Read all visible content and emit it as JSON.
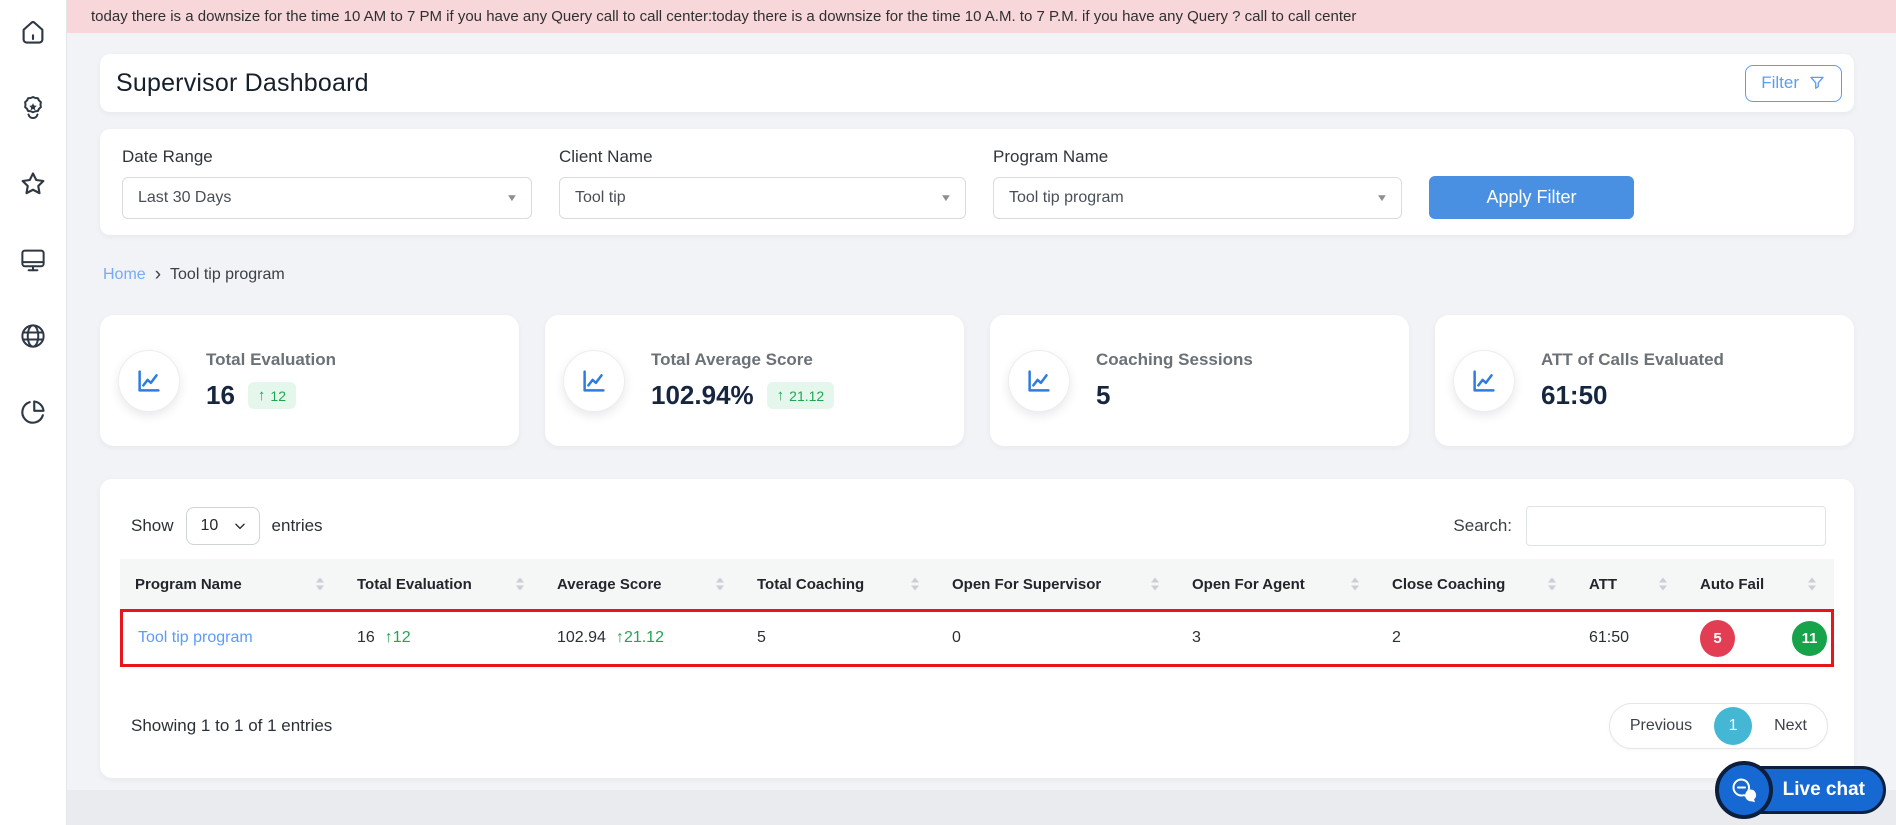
{
  "banner": {
    "text": "today there is a downsize for the time 10 AM to 7 PM if you have any Query call to call center:today there is a downsize for the time 10 A.M. to 7 P.M. if you have any Query ? call to call center"
  },
  "sidebar": {
    "items": [
      {
        "icon": "home-icon"
      },
      {
        "icon": "agent-badge-icon"
      },
      {
        "icon": "star-icon"
      },
      {
        "icon": "monitor-icon"
      },
      {
        "icon": "globe-icon"
      },
      {
        "icon": "pie-chart-icon"
      }
    ]
  },
  "header": {
    "title": "Supervisor Dashboard",
    "filter_button_label": "Filter"
  },
  "filters": {
    "date_range_label": "Date Range",
    "date_range_value": "Last 30 Days",
    "client_name_label": "Client Name",
    "client_name_value": "Tool tip",
    "program_name_label": "Program Name",
    "program_name_value": "Tool tip program",
    "apply_button_label": "Apply Filter"
  },
  "breadcrumb": {
    "home": "Home",
    "current": "Tool tip program"
  },
  "stats": [
    {
      "label": "Total Evaluation",
      "value": "16",
      "delta": "12"
    },
    {
      "label": "Total Average Score",
      "value": "102.94%",
      "delta": "21.12"
    },
    {
      "label": "Coaching Sessions",
      "value": "5"
    },
    {
      "label": "ATT of Calls Evaluated",
      "value": "61:50"
    }
  ],
  "table": {
    "show_label": "Show",
    "page_size": "10",
    "entries_label": "entries",
    "search_label": "Search:",
    "columns": [
      "Program Name",
      "Total Evaluation",
      "Average Score",
      "Total Coaching",
      "Open For Supervisor",
      "Open For Agent",
      "Close Coaching",
      "ATT",
      "Auto Fail"
    ],
    "row": {
      "program_name": "Tool tip program",
      "total_evaluation": "16",
      "total_evaluation_delta": "12",
      "average_score": "102.94",
      "average_score_delta": "21.12",
      "total_coaching": "5",
      "open_for_supervisor": "0",
      "open_for_agent": "3",
      "close_coaching": "2",
      "att": "61:50",
      "auto_fail": "5",
      "auto_pass": "11"
    },
    "summary": "Showing 1 to 1 of 1 entries",
    "pagination": {
      "previous_label": "Previous",
      "current_page": "1",
      "next_label": "Next"
    }
  },
  "livechat": {
    "label": "Live chat"
  },
  "colors": {
    "banner_bg": "#f8d7da",
    "apply_button_blue": "#4a90e2",
    "filter_outline_blue": "#5d9cf5",
    "link_blue": "#5b9cf6",
    "delta_badge_bg": "#e5f7ec",
    "delta_green": "#23a452",
    "auto_fail_red": "#e23d52",
    "auto_pass_green": "#16a34a",
    "row_highlight_red": "#e8151b",
    "pagination_active": "#43b7d3",
    "livechat_blue": "#1669d2"
  }
}
